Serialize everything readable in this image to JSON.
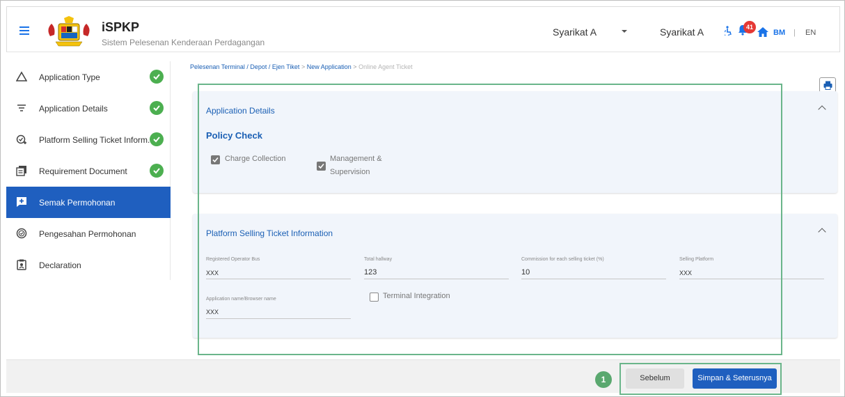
{
  "header": {
    "app_title": "iSPKP",
    "app_subtitle": "Sistem Pelesenan Kenderaan Perdagangan",
    "company_selector": "Syarikat A",
    "company_name": "Syarikat A",
    "notification_count": "41",
    "lang_bm": "BM",
    "lang_sep": "|",
    "lang_en": "EN",
    "accent_color": "#1a73e8"
  },
  "sidebar": {
    "items": [
      {
        "label": "Application Type",
        "icon": "triangle-icon",
        "completed": true
      },
      {
        "label": "Application Details",
        "icon": "filter-icon",
        "completed": true
      },
      {
        "label": "Platform Selling Ticket Inform...",
        "icon": "check-add-icon",
        "completed": true
      },
      {
        "label": "Requirement Document",
        "icon": "document-list-icon",
        "completed": true
      },
      {
        "label": "Semak Permohonan",
        "icon": "review-icon",
        "active": true
      },
      {
        "label": "Pengesahan Permohonan",
        "icon": "verify-icon"
      },
      {
        "label": "Declaration",
        "icon": "clipboard-icon"
      }
    ],
    "active_color": "#1f5fbf"
  },
  "breadcrumb": {
    "items": [
      "Pelesenan Terminal / Depot / Ejen Tiket",
      "New Application",
      "Online Agent Ticket"
    ],
    "separator": ">"
  },
  "application_details": {
    "title": "Application Details",
    "policy_title": "Policy Check",
    "checks": [
      {
        "label": "Charge Collection",
        "checked": true
      },
      {
        "label_line1": "Management &",
        "label_line2": "Supervision",
        "checked": true
      }
    ]
  },
  "platform_info": {
    "title": "Platform Selling Ticket Information",
    "fields": [
      {
        "label": "Registered Operator Bus",
        "value": "XXX"
      },
      {
        "label": "Total hallway",
        "value": "123"
      },
      {
        "label": "Commission for each selling ticket (%)",
        "value": "10"
      },
      {
        "label": "Selling Platform",
        "value": "XXX"
      },
      {
        "label": "Application name/Browser name",
        "value": "XXX"
      }
    ],
    "terminal_integration": {
      "label": "Terminal Integration",
      "checked": false
    }
  },
  "footer": {
    "step_number": "1",
    "prev_label": "Sebelum",
    "next_label": "Simpan & Seterusnya"
  }
}
